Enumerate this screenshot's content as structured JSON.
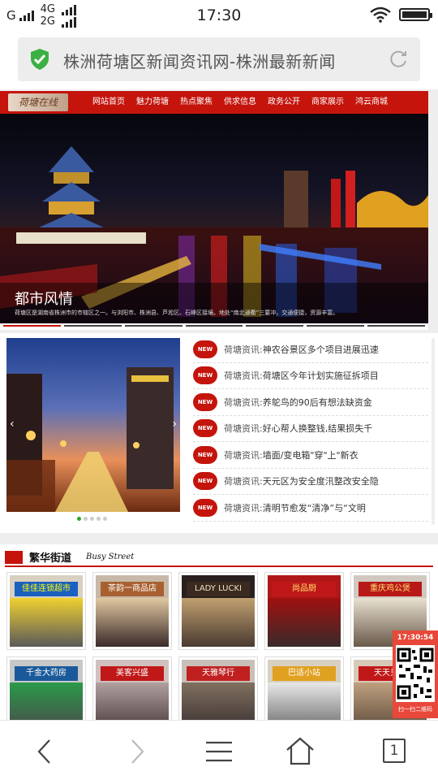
{
  "status_bar": {
    "carrier_left": "G",
    "net_top": "4G",
    "net_bottom": "2G",
    "time": "17:30"
  },
  "url_bar": {
    "page_title": "株洲荷塘区新闻资讯网-株洲最新新闻"
  },
  "site": {
    "logo_text": "荷塘在线",
    "nav": [
      "网站首页",
      "魅力荷塘",
      "热点聚焦",
      "供求信息",
      "政务公开",
      "商家展示",
      "鸿云商城"
    ],
    "hero": {
      "title": "都市风情",
      "subtitle": "荷塘区是湖南省株洲市的市辖区之一。与浏阳市、株洲县、芦淞区、石峰区接壤。地处“南北通衢”三要冲，交通便捷，资源丰富。"
    },
    "news_badge": "NEW",
    "news": [
      {
        "prefix": "荷塘资讯:",
        "title": "神农谷景区多个项目进展迅速"
      },
      {
        "prefix": "荷塘资讯:",
        "title": "荷塘区今年计划实施征拆项目"
      },
      {
        "prefix": "荷塘资讯:",
        "title": "养鸵鸟的90后有想法缺资金"
      },
      {
        "prefix": "荷塘资讯:",
        "title": "好心帮人换整钱,结果损失千"
      },
      {
        "prefix": "荷塘资讯:",
        "title": "墙面/变电箱\"穿\"上\"新衣"
      },
      {
        "prefix": "荷塘资讯:",
        "title": "天元区为安全度汛整改安全隐"
      },
      {
        "prefix": "荷塘资讯:",
        "title": "清明节愈发“清净”与“文明"
      }
    ],
    "busy_street": {
      "title_cn": "繁华街道",
      "title_en": "Busy Street",
      "shops": [
        "佳佳连锁超市",
        "茶韵一商品店",
        "LADY LUCKI",
        "尚品厨",
        "重庆鸡公煲",
        "千金大药房",
        "美客兴盛",
        "天雅琴行",
        "巴适小站",
        "天天见美"
      ]
    },
    "qr_widget": {
      "time": "17:30:54",
      "label": "扫一扫二维码"
    }
  },
  "bottom_bar": {
    "tab_count": "1"
  },
  "colors": {
    "brand_red": "#c4140c",
    "secure_green": "#3cb043"
  }
}
